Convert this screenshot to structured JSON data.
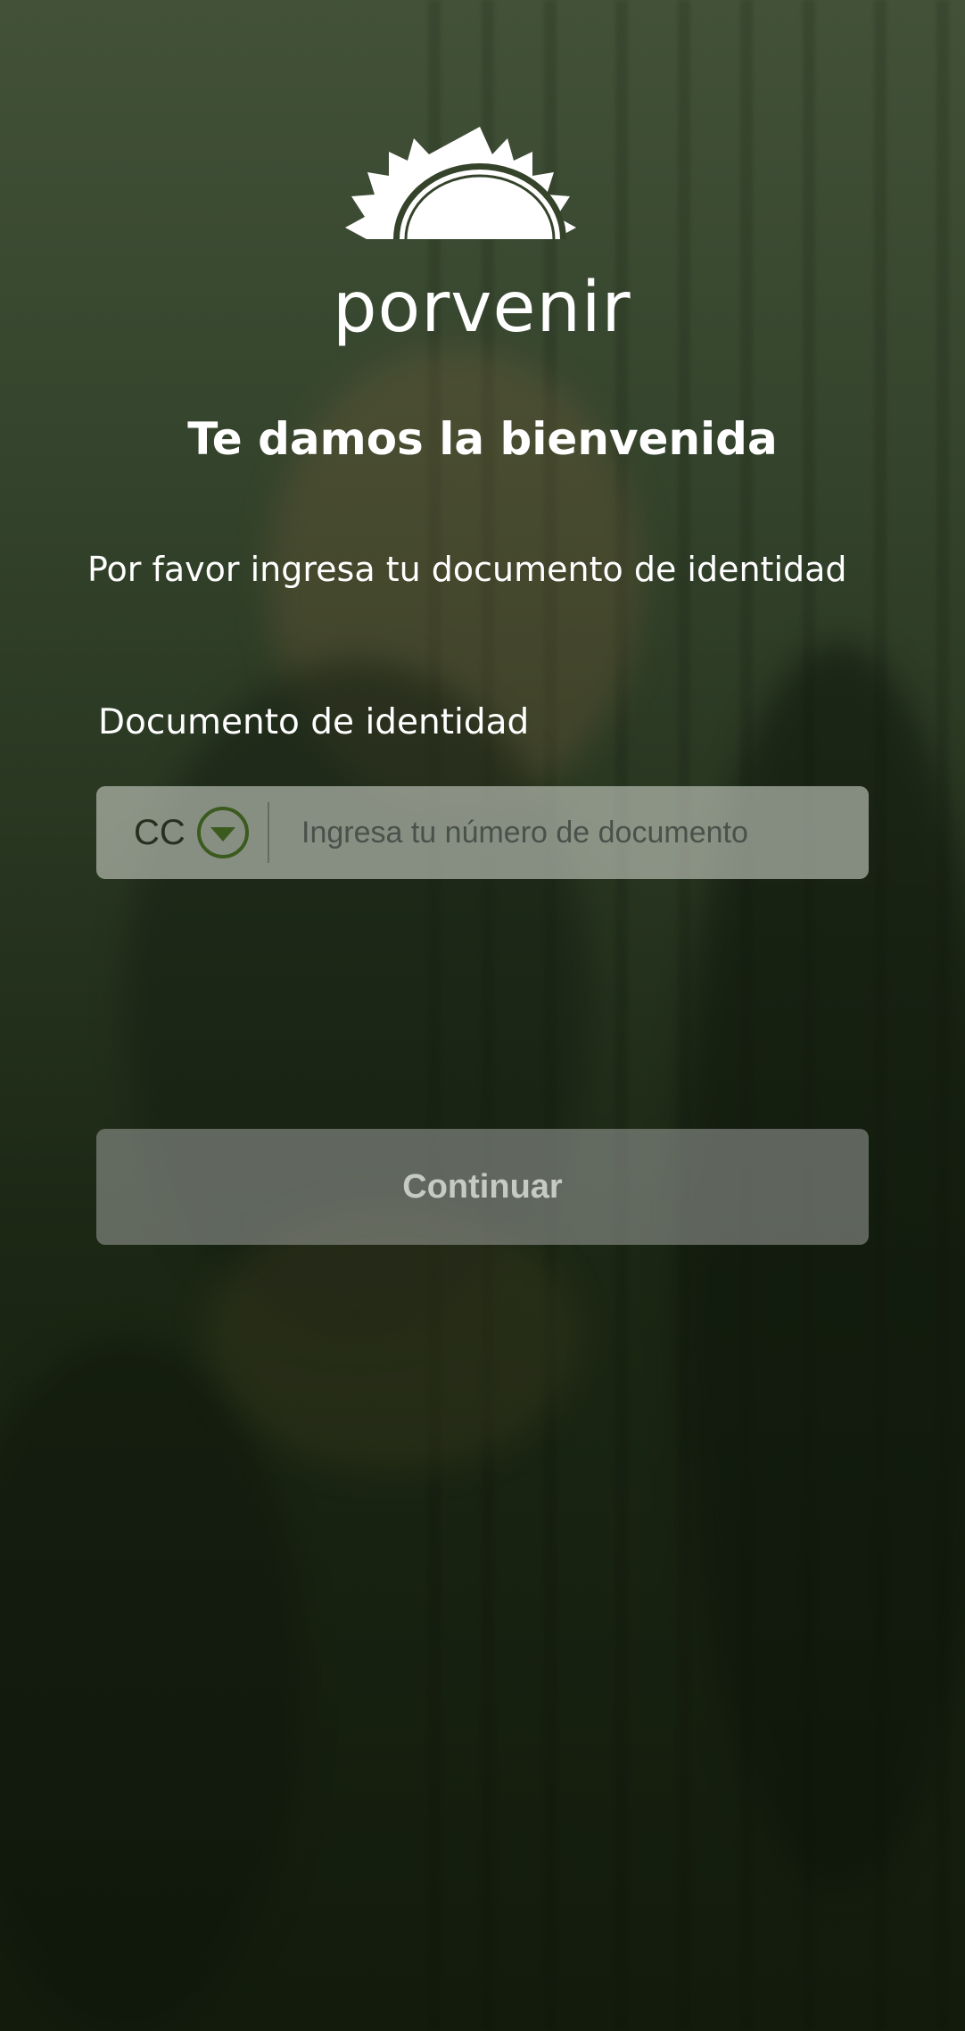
{
  "brand": {
    "name": "porvenir",
    "logo_icon": "sun-icon",
    "logo_color": "#ffffff"
  },
  "welcome": {
    "title": "Te damos la bienvenida",
    "instruction": "Por favor ingresa tu documento de identidad"
  },
  "document_field": {
    "label": "Documento de identidad",
    "type_selected": "CC",
    "dropdown_icon": "chevron-down-circle-icon",
    "placeholder": "Ingresa tu número de documento",
    "value": ""
  },
  "actions": {
    "continue_label": "Continuar",
    "continue_enabled": false
  },
  "colors": {
    "accent_green": "#3b5a1e",
    "button_disabled_bg": "#8e928c",
    "button_disabled_text": "#c6cac2"
  }
}
